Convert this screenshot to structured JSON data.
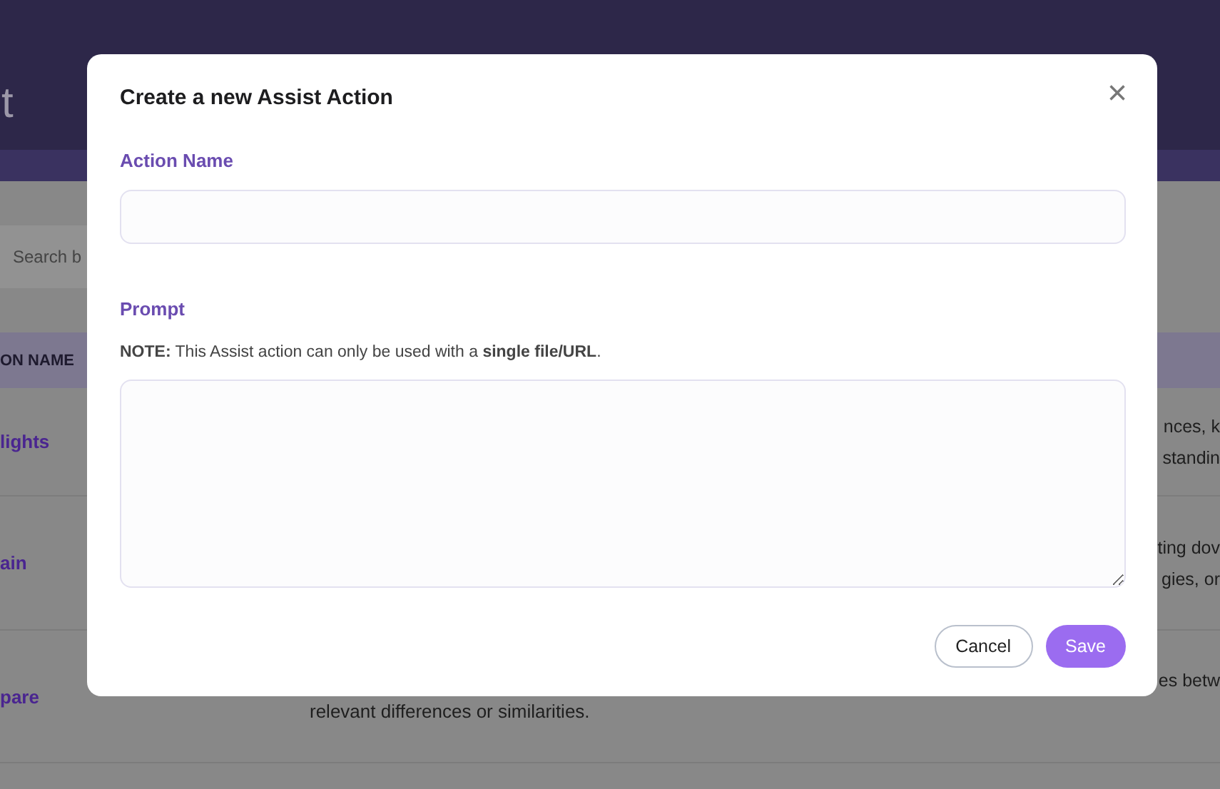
{
  "page": {
    "title_fragment": "t",
    "search": {
      "placeholder": "Search b"
    },
    "table": {
      "columns": [
        "ON NAME"
      ],
      "rows": [
        {
          "name": "lights",
          "lines": [
            {
              "kind": "tail",
              "text": "nces, k"
            },
            {
              "kind": "tail",
              "text": "standin"
            }
          ]
        },
        {
          "name": "ain",
          "lines": [
            {
              "kind": "tail",
              "text": "ting dov"
            },
            {
              "kind": "tail",
              "text": "gies, or"
            }
          ]
        },
        {
          "name": "pare",
          "lines": [
            {
              "kind": "tail",
              "text": "es betw"
            },
            {
              "kind": "full",
              "text": "relevant differences or similarities."
            }
          ]
        }
      ]
    }
  },
  "dialog": {
    "title": "Create a new Assist Action",
    "close": "×",
    "fields": [
      {
        "label": "Action Name",
        "kind": "input"
      },
      {
        "label": "Prompt",
        "kind": "textarea",
        "note": "**NOTE:** This Assist action can only be used with a **single file/URL**."
      }
    ],
    "buttons": [
      {
        "label": "Cancel",
        "kind": "secondary"
      },
      {
        "label": "Save",
        "kind": "primary"
      }
    ]
  }
}
